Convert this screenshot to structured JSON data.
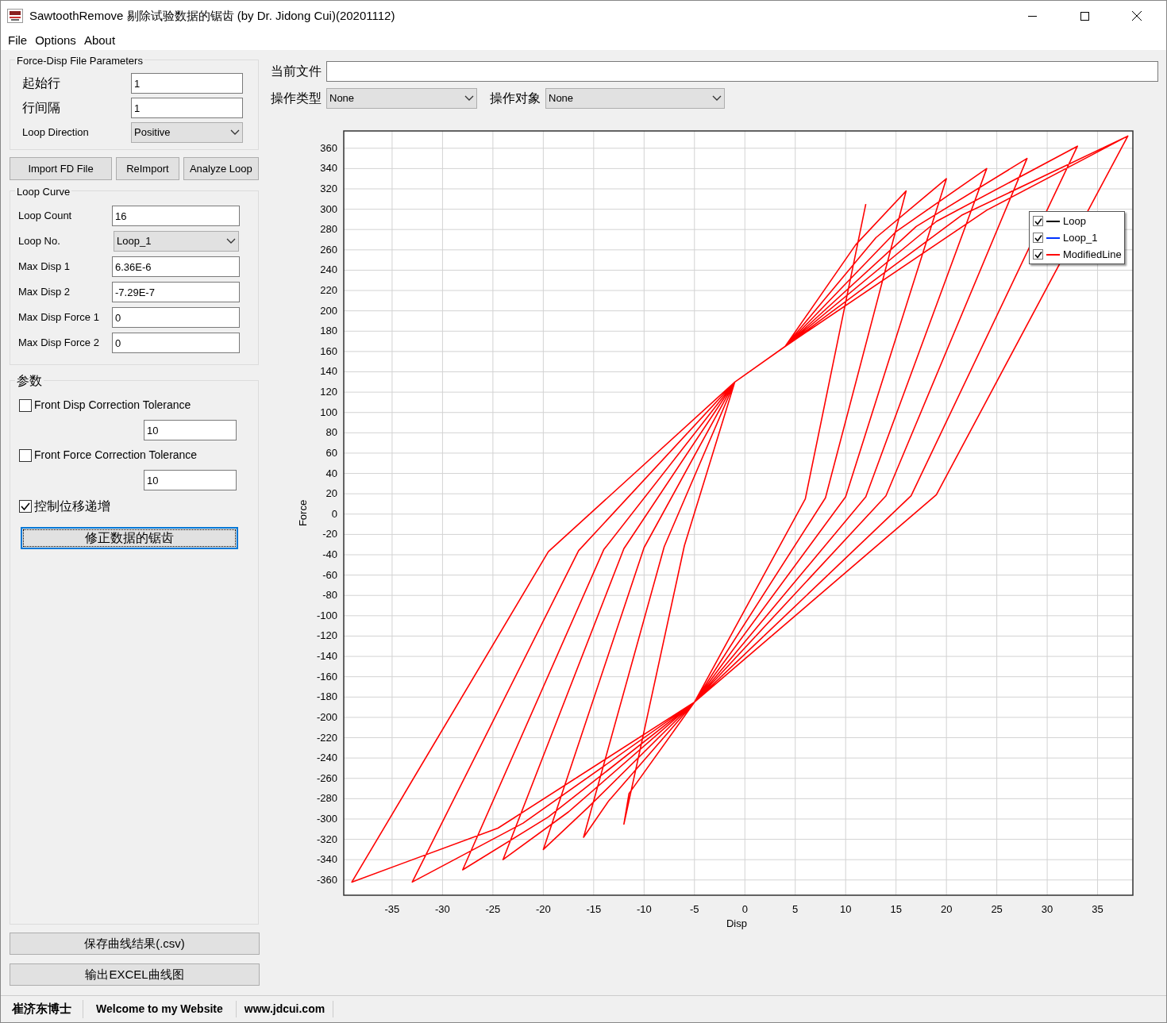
{
  "window": {
    "title": "SawtoothRemove 剔除试验数据的锯齿 (by Dr. Jidong Cui)(20201112)"
  },
  "menu": [
    "File",
    "Options",
    "About"
  ],
  "file_params": {
    "title": "Force-Disp File Parameters",
    "fields": [
      {
        "kind": "input",
        "label": "起始行",
        "value": "1"
      },
      {
        "kind": "input",
        "label": "行间隔",
        "value": "1"
      },
      {
        "kind": "select",
        "label": "Loop Direction",
        "value": "Positive"
      }
    ]
  },
  "buttons": [
    "Import FD File",
    "ReImport",
    "Analyze Loop"
  ],
  "loop_curve": {
    "title": "Loop Curve",
    "fields": [
      {
        "kind": "input",
        "label": "Loop Count",
        "value": "16"
      },
      {
        "kind": "select",
        "label": "Loop No.",
        "value": "Loop_1"
      },
      {
        "kind": "input",
        "label": "Max Disp 1",
        "value": "6.36E-6"
      },
      {
        "kind": "input",
        "label": "Max Disp 2",
        "value": "-7.29E-7"
      },
      {
        "kind": "input",
        "label": "Max Disp Force 1",
        "value": "0"
      },
      {
        "kind": "input",
        "label": "Max Disp Force 2",
        "value": "0"
      }
    ]
  },
  "params": {
    "title": "参数",
    "items": [
      {
        "kind": "checkbox",
        "label": "Front Disp Correction Tolerance",
        "checked": false
      },
      {
        "kind": "input",
        "value": "10"
      },
      {
        "kind": "checkbox",
        "label": "Front Force Correction Tolerance",
        "checked": false
      },
      {
        "kind": "input",
        "value": "10"
      },
      {
        "kind": "checkbox",
        "label": "控制位移递增",
        "checked": true
      }
    ],
    "action": "修正数据的锯齿"
  },
  "bottom_buttons": [
    "保存曲线结果(.csv)",
    "输出EXCEL曲线图"
  ],
  "current_file": {
    "label": "当前文件"
  },
  "operation_type": {
    "label": "操作类型",
    "value": "None"
  },
  "operation_target": {
    "label": "操作对象",
    "value": "None"
  },
  "chart": {
    "legend": [
      {
        "kind": "own",
        "label": "Loop",
        "color": "#000000",
        "checked": true
      },
      {
        "kind": "own",
        "label": "Loop_1",
        "color": "#0033ff",
        "checked": true
      },
      {
        "kind": "series",
        "checked": true
      }
    ],
    "chart_data": {
      "type": "line",
      "grid": true,
      "xlabel": "Disp",
      "ylabel": "Force",
      "xlim": [
        -39.8,
        38.5
      ],
      "ylim": [
        -375,
        377
      ],
      "xticks": [
        -35,
        -30,
        -25,
        -20,
        -15,
        -10,
        -5,
        0,
        5,
        10,
        15,
        20,
        25,
        30,
        35
      ],
      "yticks": [
        -360,
        -340,
        -320,
        -300,
        -280,
        -260,
        -240,
        -220,
        -200,
        -180,
        -160,
        -140,
        -120,
        -100,
        -80,
        -60,
        -40,
        -20,
        0,
        20,
        40,
        60,
        80,
        100,
        120,
        140,
        160,
        180,
        200,
        220,
        240,
        260,
        280,
        300,
        320,
        340,
        360
      ],
      "x": [
        12,
        6,
        -5,
        -11.5,
        -12,
        -6,
        -1,
        4,
        11,
        16,
        8,
        -5,
        -13.5,
        -16,
        -8,
        -1,
        4,
        13,
        20,
        10,
        -5,
        -15.5,
        -20,
        -10,
        -1,
        4,
        15,
        24,
        12,
        -5,
        -17.5,
        -24,
        -12,
        -1,
        4,
        17,
        28,
        14,
        -5,
        -19.5,
        -28,
        -14,
        -1,
        4,
        19,
        33,
        16.5,
        -5,
        -22,
        -33,
        -16.5,
        -1,
        4,
        21.5,
        38,
        19,
        -5,
        -24.5,
        -39,
        -19.5,
        -1,
        4,
        24,
        38
      ],
      "series": [
        {
          "name": "ModifiedLine",
          "color": "#ff0000",
          "values": [
            305,
            15,
            -185,
            -275,
            -305,
            -31,
            130,
            165,
            265,
            318,
            16,
            -185,
            -282,
            -318,
            -32,
            130,
            165,
            272,
            330,
            17,
            -185,
            -288,
            -330,
            -33,
            130,
            165,
            278,
            340,
            17,
            -185,
            -293,
            -340,
            -34,
            130,
            165,
            283,
            350,
            18,
            -185,
            -298,
            -350,
            -35,
            130,
            165,
            288,
            362,
            18,
            -185,
            -304,
            -362,
            -36,
            130,
            165,
            294,
            372,
            19,
            -185,
            -309,
            -362,
            -37,
            130,
            165,
            299,
            372
          ]
        }
      ]
    }
  },
  "status_bar": [
    "崔济东博士",
    "Welcome to my Website",
    "www.jdcui.com"
  ]
}
